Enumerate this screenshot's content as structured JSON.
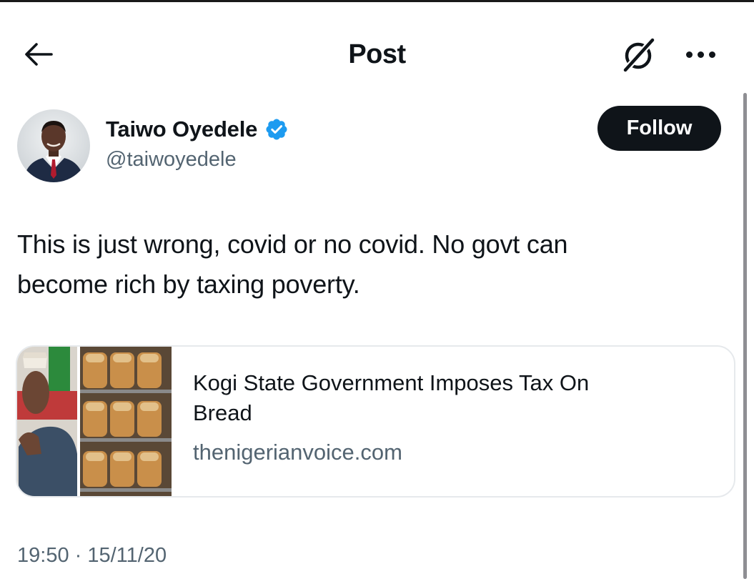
{
  "header": {
    "title": "Post",
    "back_icon": "arrow-left-icon",
    "grok_icon": "grok-icon",
    "more_icon": "more-horizontal-icon"
  },
  "author": {
    "display_name": "Taiwo Oyedele",
    "handle": "@taiwoyedele",
    "verified": true,
    "verified_color": "#1d9bf0"
  },
  "follow_button": {
    "label": "Follow"
  },
  "tweet": {
    "lines": [
      "This is just wrong, covid or no covid. No govt can",
      "become rich by taxing poverty."
    ],
    "timestamp": "19:50 · 15/11/20"
  },
  "link_card": {
    "title_lines": [
      "Kogi State Government Imposes Tax On",
      "Bread"
    ],
    "domain": "thenigerianvoice.com"
  },
  "colors": {
    "text": "#0f1419",
    "secondary": "#536471",
    "button_bg": "#0f1419",
    "card_border": "#e6e9ec"
  }
}
